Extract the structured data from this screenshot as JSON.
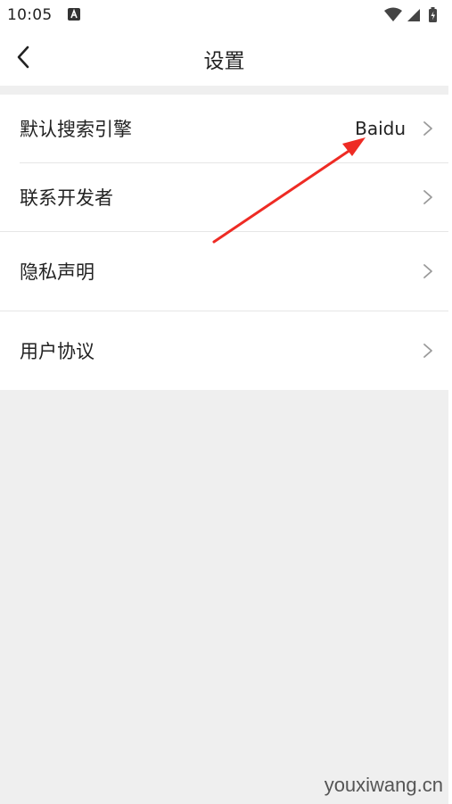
{
  "status_bar": {
    "time": "10:05",
    "icons": [
      "notification-a-icon",
      "wifi-icon",
      "signal-icon",
      "battery-icon"
    ]
  },
  "header": {
    "title": "设置"
  },
  "settings": {
    "items": [
      {
        "label": "默认搜索引擎",
        "value": "Baidu"
      },
      {
        "label": "联系开发者"
      },
      {
        "label": "隐私声明"
      },
      {
        "label": "用户协议"
      }
    ]
  },
  "annotation": {
    "color": "#ee2b24"
  },
  "watermark": "youxiwang.cn"
}
